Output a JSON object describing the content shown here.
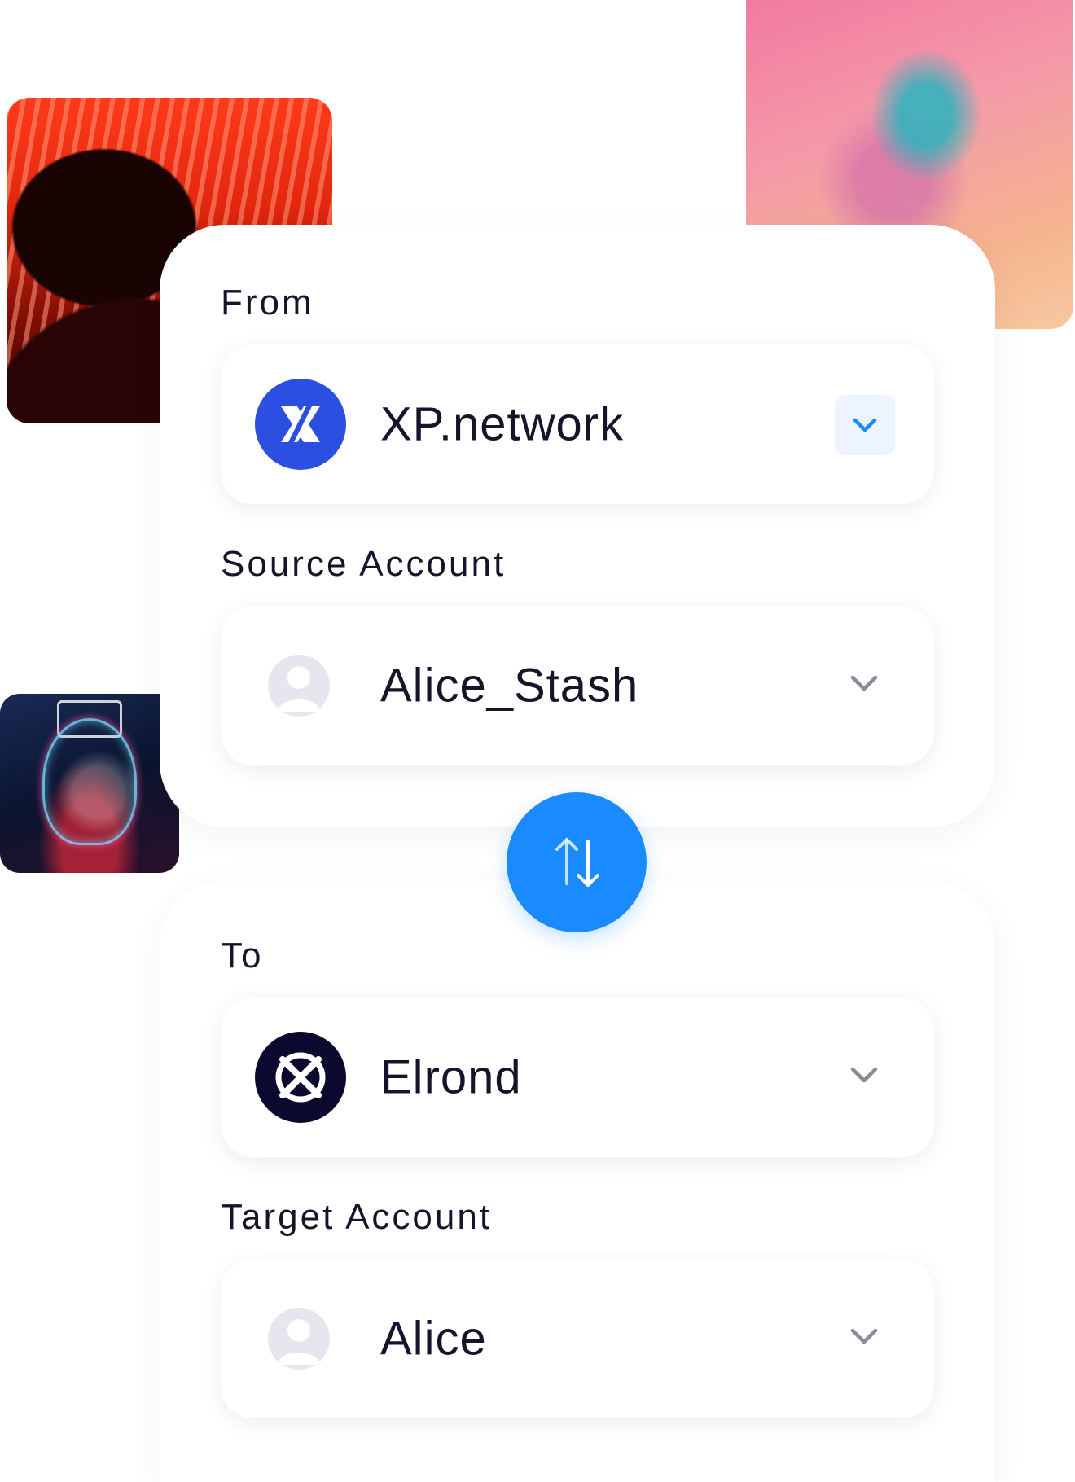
{
  "colors": {
    "accent": "#1a8bff",
    "xp_logo": "#2b4fe0",
    "elrond_logo": "#0b0a2e",
    "text": "#14142b",
    "chevron_active": "#1a8bff",
    "chevron_muted": "#8a8a99"
  },
  "images": {
    "top_left": "photo-red-light-silhouette",
    "top_right": "photo-pink-abstract",
    "left_middle": "photo-neon-skull"
  },
  "from": {
    "label": "From",
    "chain": "XP.network",
    "logo_icon": "xp-network-logo-icon",
    "chevron_icon": "chevron-down-icon"
  },
  "source_account": {
    "label": "Source Account",
    "value": "Alice_Stash",
    "avatar_icon": "user-avatar-icon",
    "chevron_icon": "chevron-down-icon"
  },
  "swap": {
    "icon": "swap-arrows-icon"
  },
  "to": {
    "label": "To",
    "chain": "Elrond",
    "logo_icon": "elrond-logo-icon",
    "chevron_icon": "chevron-down-icon"
  },
  "target_account": {
    "label": "Target Account",
    "value": "Alice",
    "avatar_icon": "user-avatar-icon",
    "chevron_icon": "chevron-down-icon"
  }
}
